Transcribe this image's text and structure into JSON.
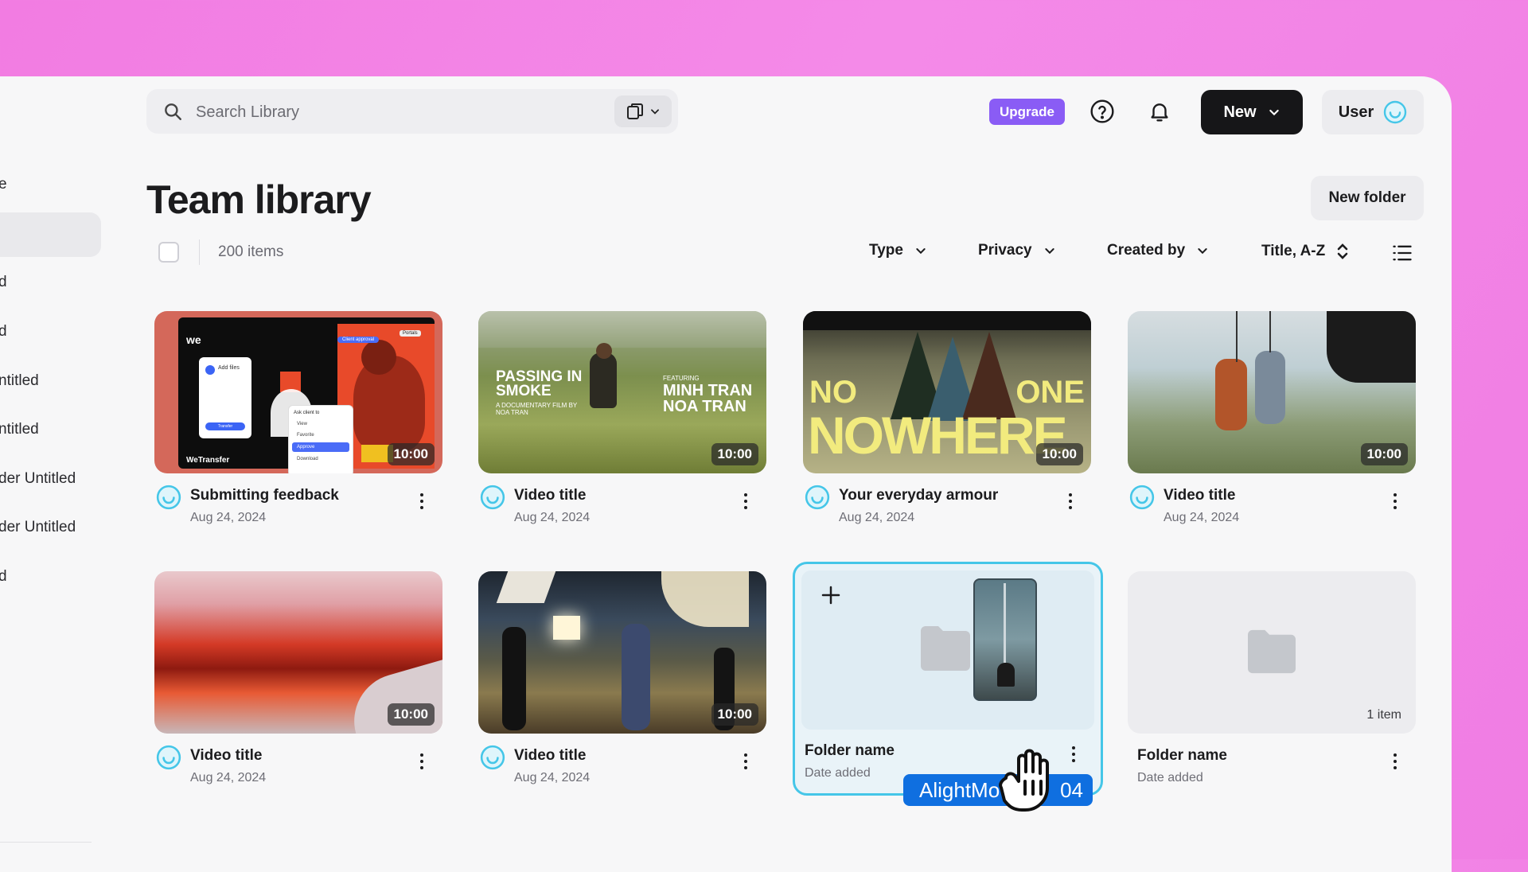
{
  "sidebar": {
    "items": [
      {
        "label": "e"
      },
      {
        "label": ""
      },
      {
        "label": "d"
      },
      {
        "label": "d"
      },
      {
        "label": "ntitled"
      },
      {
        "label": "ntitled"
      },
      {
        "label": "der Untitled"
      },
      {
        "label": "der Untitled"
      },
      {
        "label": "d"
      }
    ]
  },
  "header": {
    "search_placeholder": "Search Library",
    "upgrade_label": "Upgrade",
    "new_label": "New",
    "user_label": "User"
  },
  "library": {
    "title": "Team library",
    "new_folder_label": "New folder",
    "item_count": "200 items",
    "filters": {
      "type": "Type",
      "privacy": "Privacy",
      "created_by": "Created by",
      "sort": "Title, A-Z"
    }
  },
  "cards": [
    {
      "title": "Submitting feedback",
      "date": "Aug 24, 2024",
      "duration": "10:00"
    },
    {
      "title": "Video title",
      "date": "Aug 24, 2024",
      "duration": "10:00",
      "poster_left": "PASSING IN SMOKE",
      "poster_sub": "A DOCUMENTARY FILM BY NOA TRAN",
      "poster_feat": "FEATURING",
      "poster_right": "MINH TRAN NOA TRAN"
    },
    {
      "title": "Your everyday armour",
      "date": "Aug 24, 2024",
      "duration": "10:00",
      "poster_top_left": "NO",
      "poster_top_right": "ONE",
      "poster_main": "NOWHERE"
    },
    {
      "title": "Video title",
      "date": "Aug 24, 2024",
      "duration": "10:00"
    },
    {
      "title": "Video title",
      "date": "Aug 24, 2024",
      "duration": "10:00"
    },
    {
      "title": "Video title",
      "date": "Aug 24, 2024",
      "duration": "10:00"
    },
    {
      "title": "Folder name",
      "date": "Date added",
      "drag_file": "AlightMo",
      "drag_file_tail": "04"
    },
    {
      "title": "Folder name",
      "date": "Date added",
      "item_count": "1 item"
    }
  ],
  "wetransfer_thumb": {
    "logo": "we",
    "brand": "WeTransfer",
    "add_files": "Add files",
    "transfer": "Transfer",
    "ask_client": "Ask client to",
    "menu": [
      "View",
      "Favorite",
      "Approve",
      "Download"
    ],
    "badge": "Client approval",
    "portal": "Portals"
  },
  "colors": {
    "background": "#f27ce2",
    "accent_upgrade": "#8a5cf5",
    "selection": "#45c6e8",
    "avatar": "#45c6e8",
    "drag_pill": "#0f6fe0"
  }
}
